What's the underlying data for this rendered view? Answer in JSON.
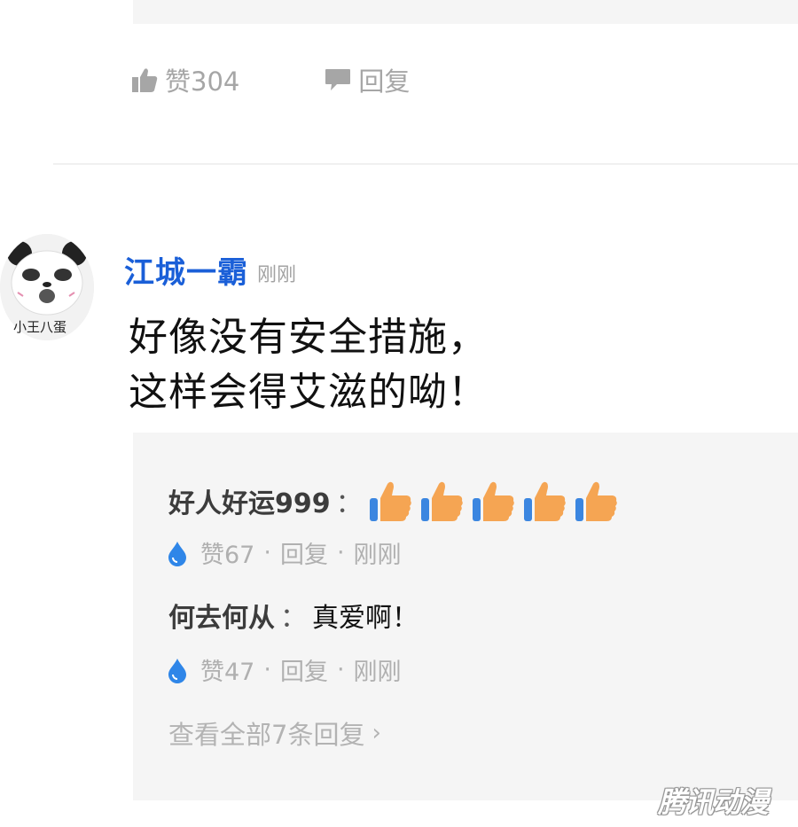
{
  "top_actions": {
    "like_label": "赞304",
    "reply_label": "回复"
  },
  "comment": {
    "username": "江城一霸",
    "timestamp": "刚刚",
    "avatar_caption": "小王八蛋",
    "body_line1": "好像没有安全措施，",
    "body_line2": "这样会得艾滋的呦！"
  },
  "replies": [
    {
      "name": "好人好运999",
      "separator": "：",
      "thumbs_count": 5,
      "likes": "赞67",
      "reply_label": "回复",
      "dot": "·",
      "time": "刚刚"
    },
    {
      "name": "何去何从",
      "separator": "：",
      "text": "真爱啊！",
      "likes": "赞47",
      "reply_label": "回复",
      "dot": "·",
      "time": "刚刚"
    }
  ],
  "view_all": {
    "label": "查看全部7条回复",
    "chevron": "›"
  },
  "watermark": "腾讯动漫",
  "colors": {
    "username": "#1a5fd8",
    "meta_gray": "#b0b0b0",
    "reply_bg": "#f5f5f5",
    "drop_blue": "#2f86e8",
    "thumb_orange": "#f5a553",
    "thumb_cuff": "#3b86e0"
  },
  "icons": {
    "like": "thumbs-up-icon",
    "reply": "speech-bubble-icon",
    "reply_like": "water-drop-icon",
    "emoji": "thumbs-up-emoji-icon"
  }
}
